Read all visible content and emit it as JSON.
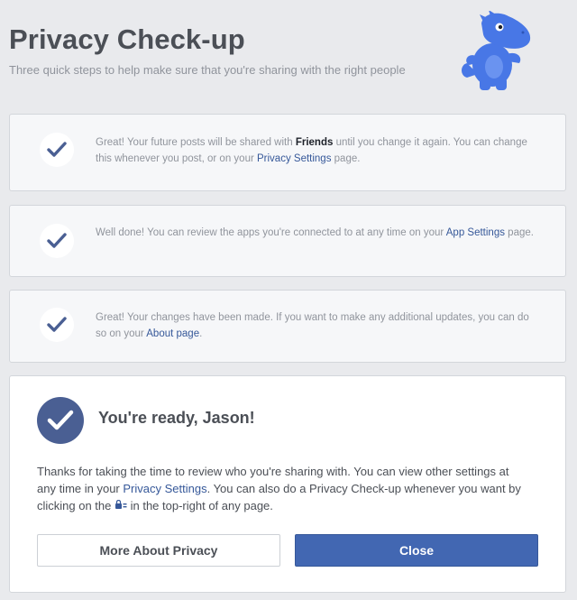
{
  "header": {
    "title": "Privacy Check-up",
    "subtitle": "Three quick steps to help make sure that you're sharing with the right people",
    "mascot_icon": "dinosaur-mascot"
  },
  "steps": [
    {
      "icon": "check-icon",
      "text_before": "Great! Your future posts will be shared with ",
      "bold": "Friends",
      "text_middle": " until you change it again. You can change this whenever you post, or on your ",
      "link": "Privacy Settings",
      "text_after": " page."
    },
    {
      "icon": "check-icon",
      "text_before": "Well done! You can review the apps you're connected to at any time on your ",
      "link": "App Settings",
      "text_after": " page."
    },
    {
      "icon": "check-icon",
      "text_before": "Great! Your changes have been made. If you want to make any additional updates, you can do so on your ",
      "link": "About page",
      "text_after": "."
    }
  ],
  "final": {
    "icon": "check-circle-icon",
    "heading": "You're ready, Jason!",
    "text_part1": "Thanks for taking the time to review who you're sharing with. You can view other settings at any time in your ",
    "link": "Privacy Settings",
    "text_part2": ". You can also do a Privacy Check-up whenever you want by clicking on the ",
    "lock_icon": "privacy-shortcuts-icon",
    "text_part3": " in the top-right of any page.",
    "buttons": {
      "more_label": "More About Privacy",
      "close_label": "Close"
    }
  },
  "colors": {
    "background": "#e9eaed",
    "link": "#365899",
    "primary_button": "#4267b2",
    "check": "#4a5f93",
    "mascot": "#4877e6"
  }
}
